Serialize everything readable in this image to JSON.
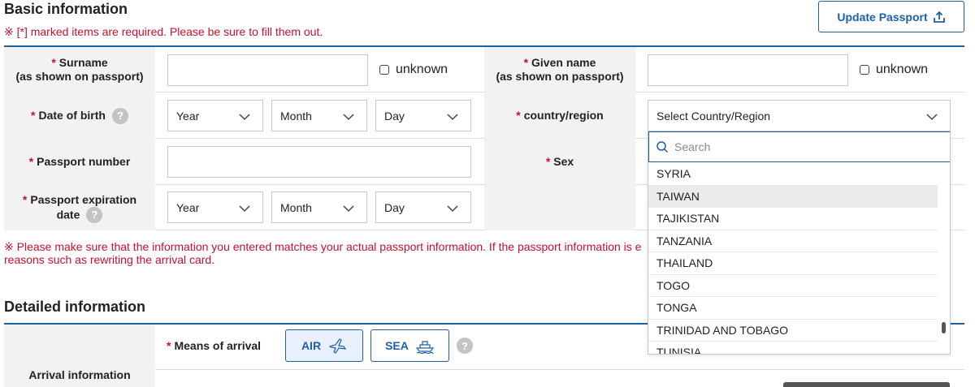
{
  "basic": {
    "title": "Basic information",
    "required_note": "※ [*] marked items are required. Please be sure to fill them out.",
    "update_button": "Update Passport",
    "required_mark": "*",
    "help_mark": "?",
    "surname_label_1": "Surname",
    "surname_label_2": "(as shown on passport)",
    "given_label_1": "Given name",
    "given_label_2": "(as shown on passport)",
    "unknown_label": "unknown",
    "dob_label": "Date of birth",
    "country_label": "country/region",
    "passport_number_label": "Passport number",
    "sex_label": "Sex",
    "expiration_label_1": "Passport expiration",
    "expiration_label_2": "date",
    "year_value": "Year",
    "month_value": "Month",
    "day_value": "Day",
    "country_value": "Select Country/Region",
    "passport_note_1": "※ Please make sure that the information you entered matches your actual passport information. If the passport information is e",
    "passport_note_2": "reasons such as rewriting the arrival card."
  },
  "dropdown": {
    "search_placeholder": "Search",
    "items": [
      "SYRIA",
      "TAIWAN",
      "TAJIKISTAN",
      "TANZANIA",
      "THAILAND",
      "TOGO",
      "TONGA",
      "TRINIDAD AND TOBAGO",
      "TUNISIA"
    ],
    "highlighted": "TAIWAN"
  },
  "detailed": {
    "title": "Detailed information",
    "arrival_info_label": "Arrival information",
    "means_label": "Means of arrival",
    "air_label": "AIR",
    "sea_label": "SEA"
  },
  "colors": {
    "accent": "#1d5fa8",
    "required": "#c8102e",
    "label_bg": "#f2f2f2"
  }
}
